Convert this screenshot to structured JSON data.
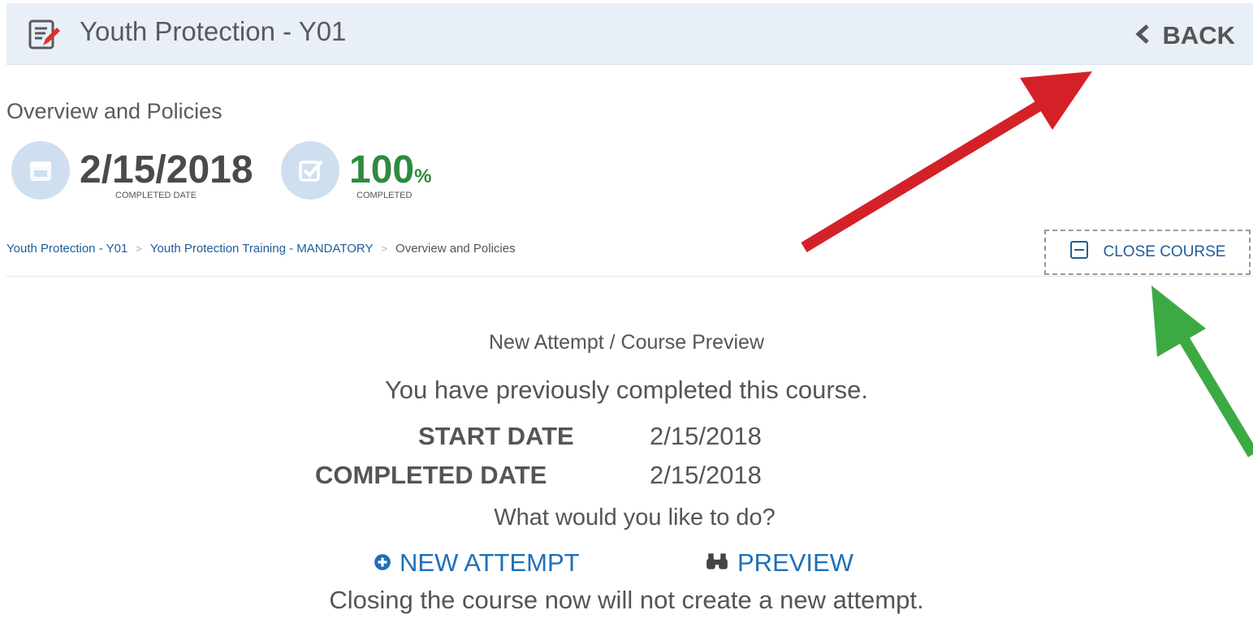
{
  "header": {
    "title": "Youth Protection - Y01",
    "back_label": "BACK"
  },
  "section_title": "Overview and Policies",
  "stats": {
    "completed_date": {
      "value": "2/15/2018",
      "label": "COMPLETED DATE",
      "icon": "calendar-icon"
    },
    "completed": {
      "value": "100",
      "unit": "%",
      "label": "COMPLETED",
      "icon": "checkbox-icon"
    }
  },
  "breadcrumb": {
    "items": [
      "Youth Protection - Y01",
      "Youth Protection Training - MANDATORY"
    ],
    "current": "Overview and Policies"
  },
  "close_course_label": "CLOSE COURSE",
  "main": {
    "heading": "New Attempt / Course Preview",
    "message": "You have previously completed this course.",
    "start_date_label": "START DATE",
    "start_date_value": "2/15/2018",
    "completed_date_label": "COMPLETED DATE",
    "completed_date_value": "2/15/2018",
    "question": "What would you like to do?",
    "new_attempt_label": "NEW ATTEMPT",
    "preview_label": "PREVIEW",
    "note": "Closing the course now will not create a new attempt."
  },
  "colors": {
    "header_bg": "#e9eff7",
    "link_blue": "#1f6fb8",
    "percent_green": "#2e8b3e",
    "red_arrow": "#d42128",
    "green_arrow": "#3caa43"
  }
}
